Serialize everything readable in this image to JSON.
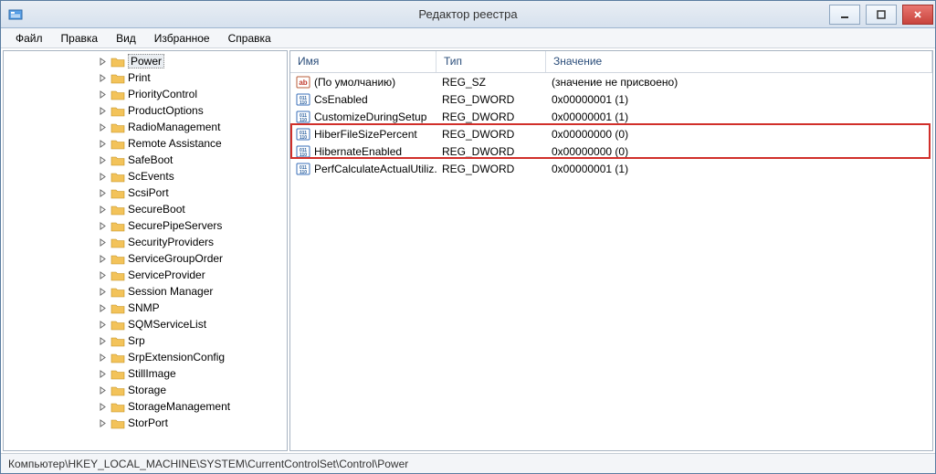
{
  "window": {
    "title": "Редактор реестра"
  },
  "menu": {
    "file": "Файл",
    "edit": "Правка",
    "view": "Вид",
    "favorites": "Избранное",
    "help": "Справка"
  },
  "tree": {
    "items": [
      {
        "label": "Power",
        "selected": true
      },
      {
        "label": "Print"
      },
      {
        "label": "PriorityControl"
      },
      {
        "label": "ProductOptions"
      },
      {
        "label": "RadioManagement"
      },
      {
        "label": "Remote Assistance"
      },
      {
        "label": "SafeBoot"
      },
      {
        "label": "ScEvents"
      },
      {
        "label": "ScsiPort"
      },
      {
        "label": "SecureBoot"
      },
      {
        "label": "SecurePipeServers"
      },
      {
        "label": "SecurityProviders"
      },
      {
        "label": "ServiceGroupOrder"
      },
      {
        "label": "ServiceProvider"
      },
      {
        "label": "Session Manager"
      },
      {
        "label": "SNMP"
      },
      {
        "label": "SQMServiceList"
      },
      {
        "label": "Srp"
      },
      {
        "label": "SrpExtensionConfig"
      },
      {
        "label": "StillImage"
      },
      {
        "label": "Storage"
      },
      {
        "label": "StorageManagement"
      },
      {
        "label": "StorPort"
      }
    ]
  },
  "list": {
    "columns": {
      "name": "Имя",
      "type": "Тип",
      "value": "Значение"
    },
    "rows": [
      {
        "icon": "sz",
        "name": "(По умолчанию)",
        "type": "REG_SZ",
        "value": "(значение не присвоено)"
      },
      {
        "icon": "dw",
        "name": "CsEnabled",
        "type": "REG_DWORD",
        "value": "0x00000001 (1)"
      },
      {
        "icon": "dw",
        "name": "CustomizeDuringSetup",
        "type": "REG_DWORD",
        "value": "0x00000001 (1)"
      },
      {
        "icon": "dw",
        "name": "HiberFileSizePercent",
        "type": "REG_DWORD",
        "value": "0x00000000 (0)"
      },
      {
        "icon": "dw",
        "name": "HibernateEnabled",
        "type": "REG_DWORD",
        "value": "0x00000000 (0)"
      },
      {
        "icon": "dw",
        "name": "PerfCalculateActualUtiliz...",
        "type": "REG_DWORD",
        "value": "0x00000001 (1)"
      }
    ]
  },
  "status": {
    "path": "Компьютер\\HKEY_LOCAL_MACHINE\\SYSTEM\\CurrentControlSet\\Control\\Power"
  }
}
